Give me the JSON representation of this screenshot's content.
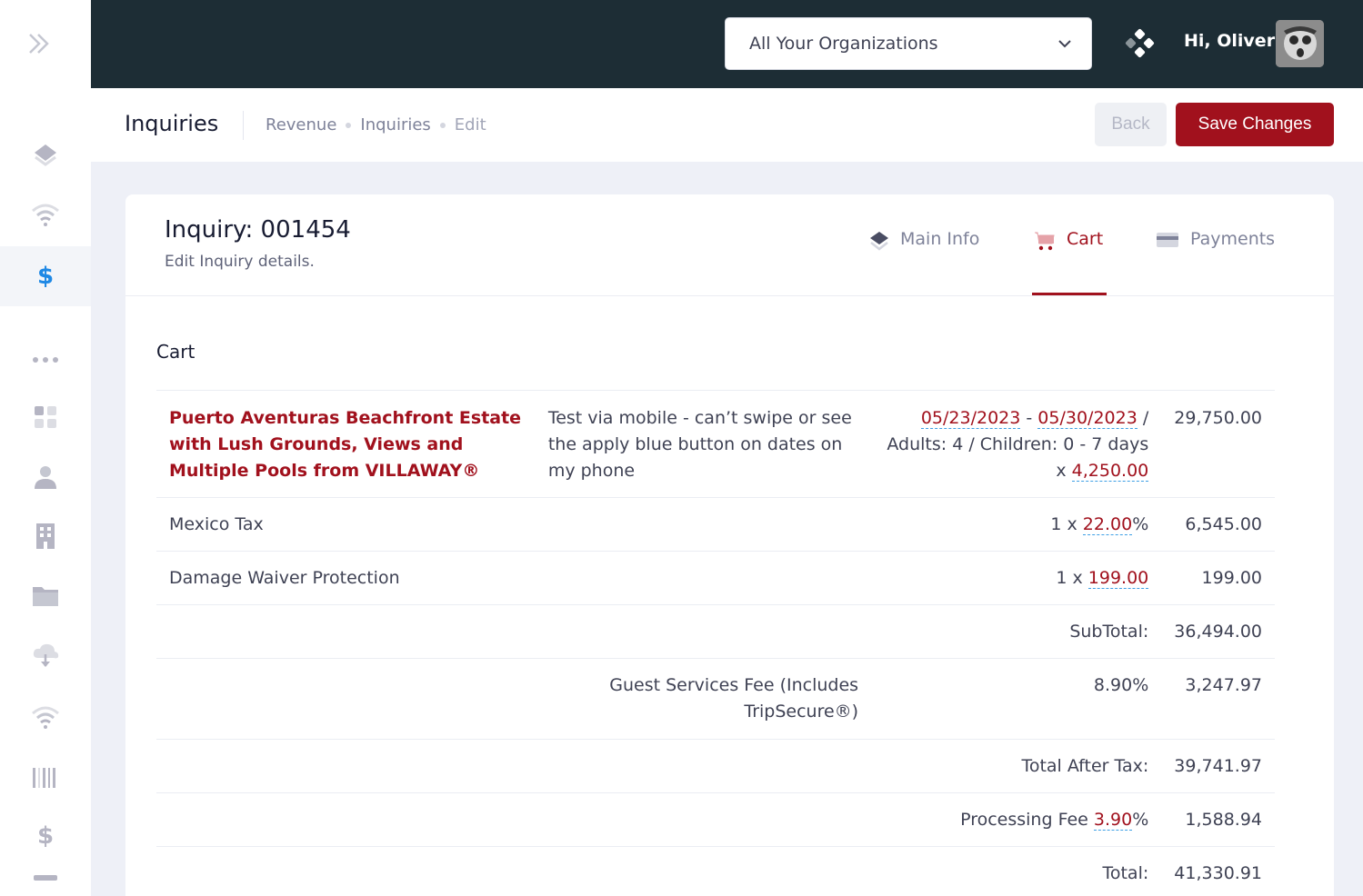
{
  "header": {
    "org_select": "All Your Organizations",
    "greeting": "Hi, Oliver"
  },
  "subheader": {
    "title": "Inquiries",
    "breadcrumb": [
      "Revenue",
      "Inquiries",
      "Edit"
    ],
    "back_label": "Back",
    "save_label": "Save Changes"
  },
  "inquiry": {
    "title": "Inquiry: 001454",
    "subtitle": "Edit Inquiry details."
  },
  "tabs": [
    {
      "label": "Main Info",
      "icon": "layers-icon",
      "active": false
    },
    {
      "label": "Cart",
      "icon": "cart-icon",
      "active": true
    },
    {
      "label": "Payments",
      "icon": "credit-card-icon",
      "active": false
    }
  ],
  "cart": {
    "section_title": "Cart",
    "item": {
      "name": "Puerto Aventuras Beachfront Estate with Lush Grounds, Views and Multiple Pools from VILLAWAY®",
      "description": "Test via mobile - can’t swipe or see the apply blue button on dates on my phone",
      "start_date": "05/23/2023",
      "date_sep": "-",
      "end_date": "05/30/2023",
      "slash": "/",
      "guests": "Adults: 4 / Children: 0 - 7 days",
      "rate_prefix": "x",
      "rate": "4,250.00",
      "amount": "29,750.00"
    },
    "tax": {
      "label": "Mexico Tax",
      "qty_prefix": "1 x",
      "rate": "22.00",
      "suffix": "%",
      "amount": "6,545.00"
    },
    "waiver": {
      "label": "Damage Waiver Protection",
      "qty_prefix": "1 x",
      "rate": "199.00",
      "amount": "199.00"
    },
    "subtotal": {
      "label": "SubTotal:",
      "amount": "36,494.00"
    },
    "guest_fee": {
      "label": "Guest Services Fee (Includes TripSecure®)",
      "rate": "8.90%",
      "amount": "3,247.97"
    },
    "total_after_tax": {
      "label": "Total After Tax:",
      "amount": "39,741.97"
    },
    "processing_fee": {
      "label": "Processing Fee",
      "rate": "3.90",
      "suffix": "%",
      "amount": "1,588.94"
    },
    "total": {
      "label": "Total:",
      "amount": "41,330.91"
    }
  },
  "colors": {
    "accent": "#a1111d",
    "topbar": "#1d2d35",
    "active_sidebar_icon": "#1e88e5"
  }
}
